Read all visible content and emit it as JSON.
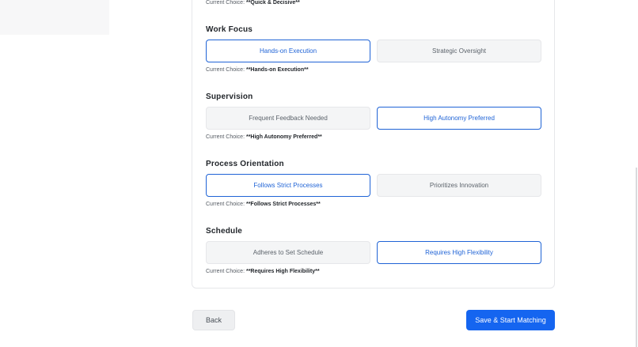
{
  "page": {
    "choice_prefix": "Current Choice: "
  },
  "colors": {
    "accent": "#1f63d6",
    "primary_button": "#1565f0",
    "unselected_bg": "#f4f5f6"
  },
  "top_choice": {
    "value": "**Quick & Decisive**"
  },
  "sections": [
    {
      "title": "Work Focus",
      "options": [
        {
          "label": "Hands-on Execution",
          "selected": true
        },
        {
          "label": "Strategic Oversight",
          "selected": false
        }
      ],
      "current_choice": "**Hands-on Execution**"
    },
    {
      "title": "Supervision",
      "options": [
        {
          "label": "Frequent Feedback Needed",
          "selected": false
        },
        {
          "label": "High Autonomy Preferred",
          "selected": true
        }
      ],
      "current_choice": "**High Autonomy Preferred**"
    },
    {
      "title": "Process Orientation",
      "options": [
        {
          "label": "Follows Strict Processes",
          "selected": true
        },
        {
          "label": "Prioritizes Innovation",
          "selected": false
        }
      ],
      "current_choice": "**Follows Strict Processes**"
    },
    {
      "title": "Schedule",
      "options": [
        {
          "label": "Adheres to Set Schedule",
          "selected": false
        },
        {
          "label": "Requires High Flexibility",
          "selected": true
        }
      ],
      "current_choice": "**Requires High Flexibility**"
    }
  ],
  "footer": {
    "back_label": "Back",
    "submit_label": "Save & Start Matching"
  }
}
